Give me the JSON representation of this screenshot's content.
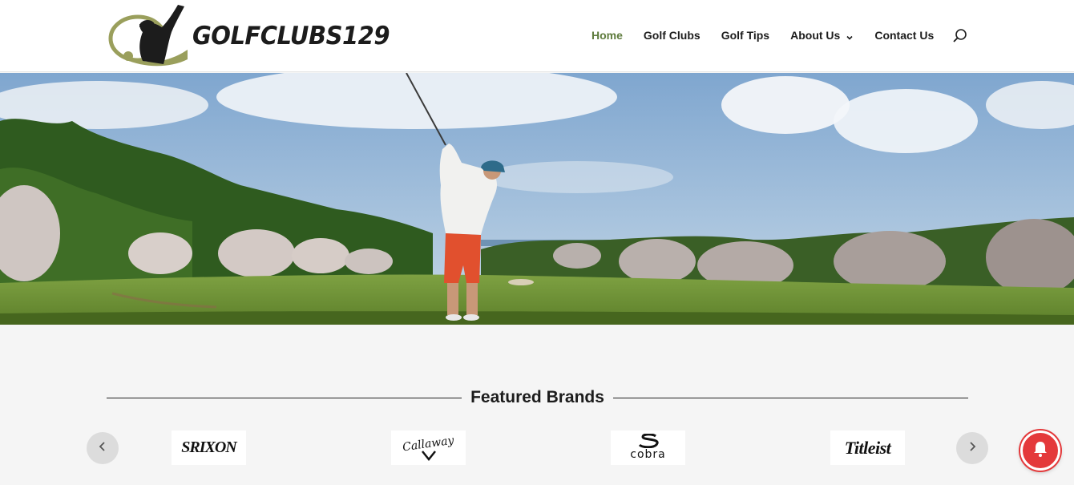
{
  "site": {
    "logo_text": "GOLFCLUBS129",
    "logo_icon": "golfer-swing-logo-icon"
  },
  "nav": {
    "items": [
      {
        "label": "Home",
        "active": true
      },
      {
        "label": "Golf Clubs",
        "active": false
      },
      {
        "label": "Golf Tips",
        "active": false
      },
      {
        "label": "About Us",
        "active": false,
        "has_dropdown": true
      },
      {
        "label": "Contact Us",
        "active": false
      }
    ],
    "search_icon": "search-icon"
  },
  "hero": {
    "image": "golfer-teeing-off-on-course"
  },
  "featured": {
    "heading": "Featured Brands",
    "brands": [
      {
        "name": "SRIXON"
      },
      {
        "name": "Callaway"
      },
      {
        "name": "cobra"
      },
      {
        "name": "Titleist"
      }
    ],
    "prev_icon": "chevron-left-icon",
    "next_icon": "chevron-right-icon"
  },
  "notification": {
    "icon": "bell-icon"
  },
  "colors": {
    "accent": "#5e7b3c",
    "logo_olive": "#9a9f5c",
    "notify_red": "#e4393b",
    "section_bg": "#f5f5f5"
  }
}
